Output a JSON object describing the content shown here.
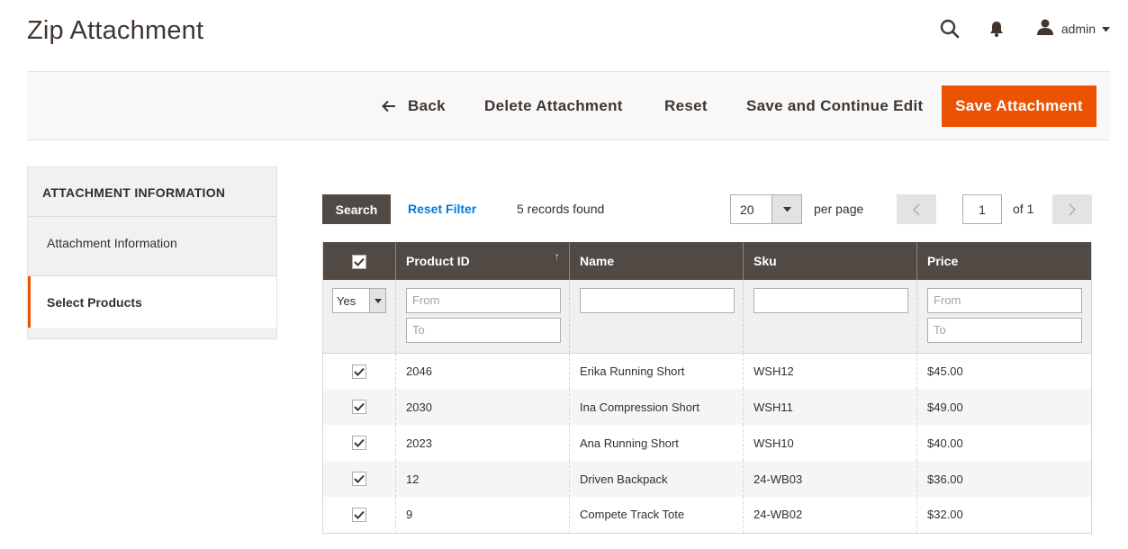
{
  "page": {
    "title": "Zip Attachment"
  },
  "header": {
    "admin_name": "admin",
    "icons": [
      "search-icon",
      "bell-icon",
      "user-icon",
      "caret-down-icon"
    ]
  },
  "actions": {
    "back": "Back",
    "delete": "Delete Attachment",
    "reset": "Reset",
    "save_continue": "Save and Continue Edit",
    "save": "Save Attachment",
    "save_color": "#eb5202"
  },
  "sidebar": {
    "title": "ATTACHMENT INFORMATION",
    "items": [
      {
        "label": "Attachment Information",
        "active": false
      },
      {
        "label": "Select Products",
        "active": true
      }
    ]
  },
  "grid_toolbar": {
    "search": "Search",
    "reset_filter": "Reset Filter",
    "records": "5 records found",
    "per_page_value": "20",
    "per_page_label": "per page",
    "page": "1",
    "of": "of 1"
  },
  "grid": {
    "columns": [
      "Product ID",
      "Name",
      "Sku",
      "Price"
    ],
    "filters": {
      "in_products": "Yes",
      "id_from": "From",
      "id_to": "To",
      "price_from": "From",
      "price_to": "To"
    },
    "rows": [
      {
        "checked": true,
        "id": "2046",
        "name": "Erika Running Short",
        "sku": "WSH12",
        "price": "$45.00"
      },
      {
        "checked": true,
        "id": "2030",
        "name": "Ina Compression Short",
        "sku": "WSH11",
        "price": "$49.00"
      },
      {
        "checked": true,
        "id": "2023",
        "name": "Ana Running Short",
        "sku": "WSH10",
        "price": "$40.00"
      },
      {
        "checked": true,
        "id": "12",
        "name": "Driven Backpack",
        "sku": "24-WB03",
        "price": "$36.00"
      },
      {
        "checked": true,
        "id": "9",
        "name": "Compete Track Tote",
        "sku": "24-WB02",
        "price": "$32.00"
      }
    ]
  }
}
